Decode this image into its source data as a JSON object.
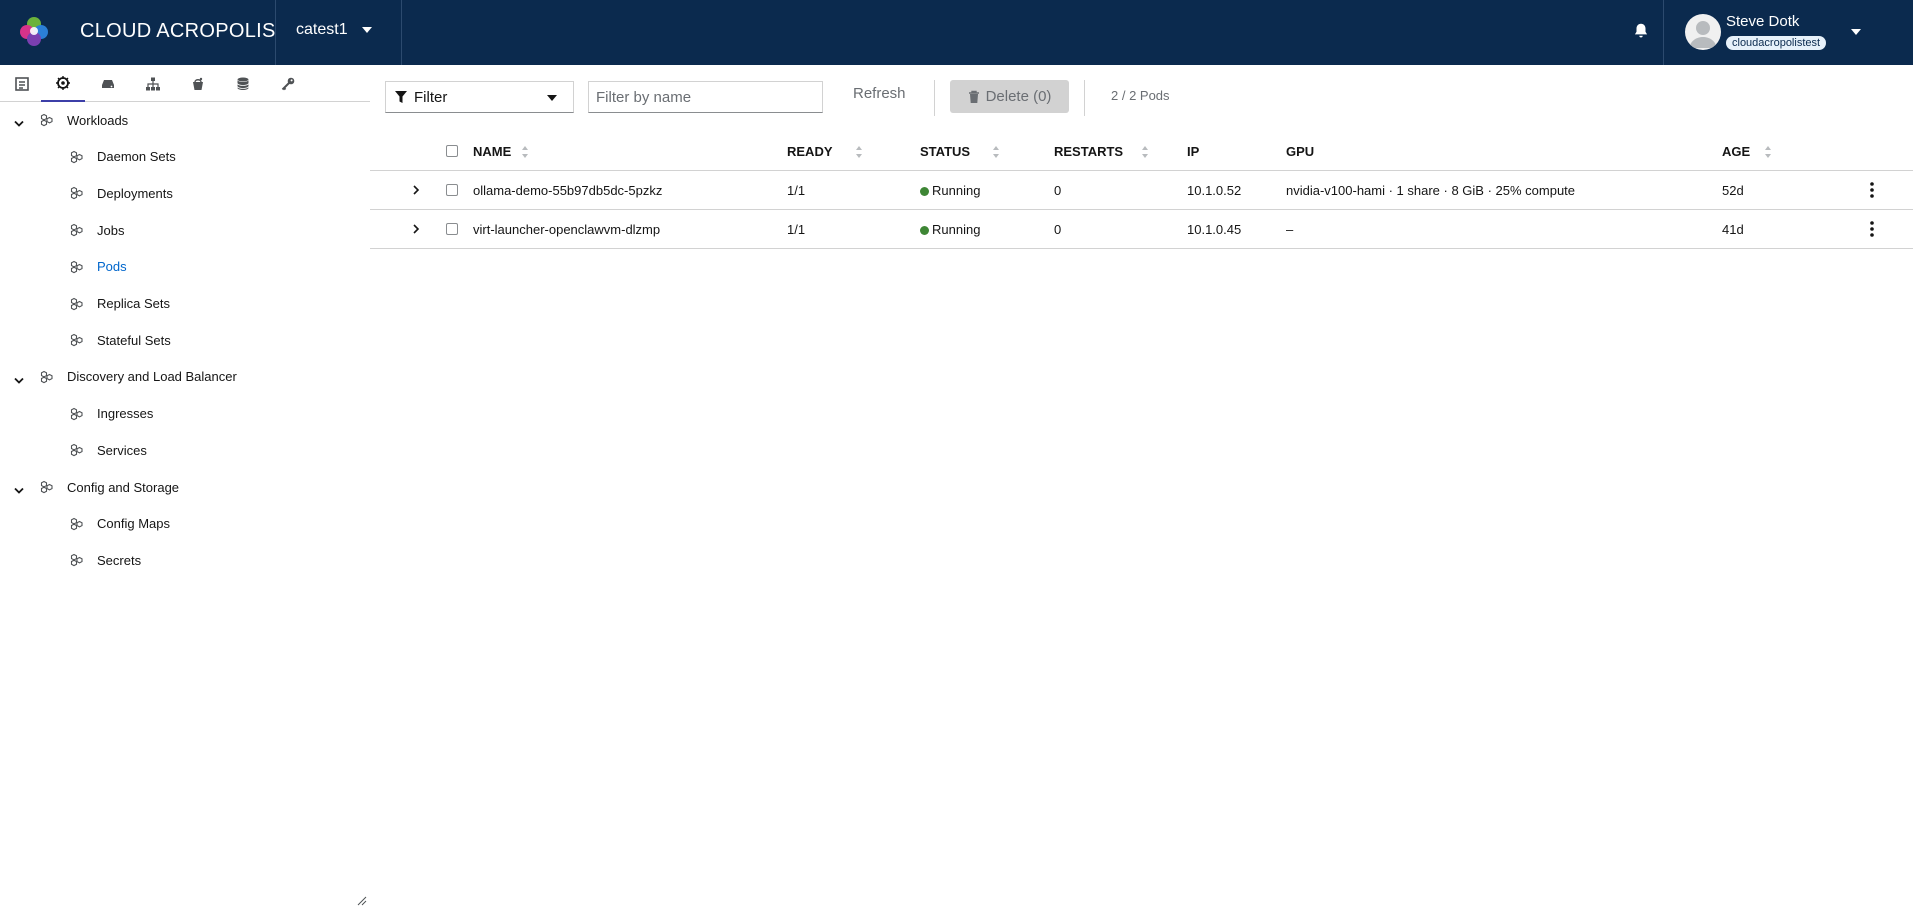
{
  "header": {
    "brand": "CLOUD ACROPOLIS",
    "context": "catest1",
    "user_name": "Steve Dotk",
    "user_org": "cloudacropolistest",
    "icons": [
      "logo-icon",
      "bell-icon",
      "avatar-icon",
      "chevron-down-icon"
    ]
  },
  "sidebar": {
    "tab_icons": [
      "overview-icon",
      "kubernetes-icon",
      "storage-icon",
      "network-icon",
      "bucket-icon",
      "database-icon",
      "key-icon"
    ],
    "active_tab": 1,
    "groups": [
      {
        "label": "Workloads",
        "items": [
          "Daemon Sets",
          "Deployments",
          "Jobs",
          "Pods",
          "Replica Sets",
          "Stateful Sets"
        ]
      },
      {
        "label": "Discovery and Load Balancer",
        "items": [
          "Ingresses",
          "Services"
        ]
      },
      {
        "label": "Config and Storage",
        "items": [
          "Config Maps",
          "Secrets"
        ]
      }
    ],
    "active_item": "Pods"
  },
  "toolbar": {
    "filter_label": "Filter",
    "search_placeholder": "Filter by name",
    "refresh_label": "Refresh",
    "delete_label": "Delete (0)",
    "count_label": "2 / 2 Pods"
  },
  "table": {
    "columns": [
      "NAME",
      "READY",
      "STATUS",
      "RESTARTS",
      "IP",
      "GPU",
      "AGE"
    ],
    "rows": [
      {
        "name": "ollama-demo-55b97db5dc-5pzkz",
        "ready": "1/1",
        "status": "Running",
        "restarts": "0",
        "ip": "10.1.0.52",
        "gpu": "nvidia-v100-hami · 1 share · 8 GiB · 25% compute",
        "age": "52d"
      },
      {
        "name": "virt-launcher-openclawvm-dlzmp",
        "ready": "1/1",
        "status": "Running",
        "restarts": "0",
        "ip": "10.1.0.45",
        "gpu": "–",
        "age": "41d"
      }
    ]
  },
  "colors": {
    "header_bg": "#0b2a4e",
    "accent": "#06c",
    "active_tab_underline": "#3c3fa8",
    "running": "#3e8635"
  }
}
